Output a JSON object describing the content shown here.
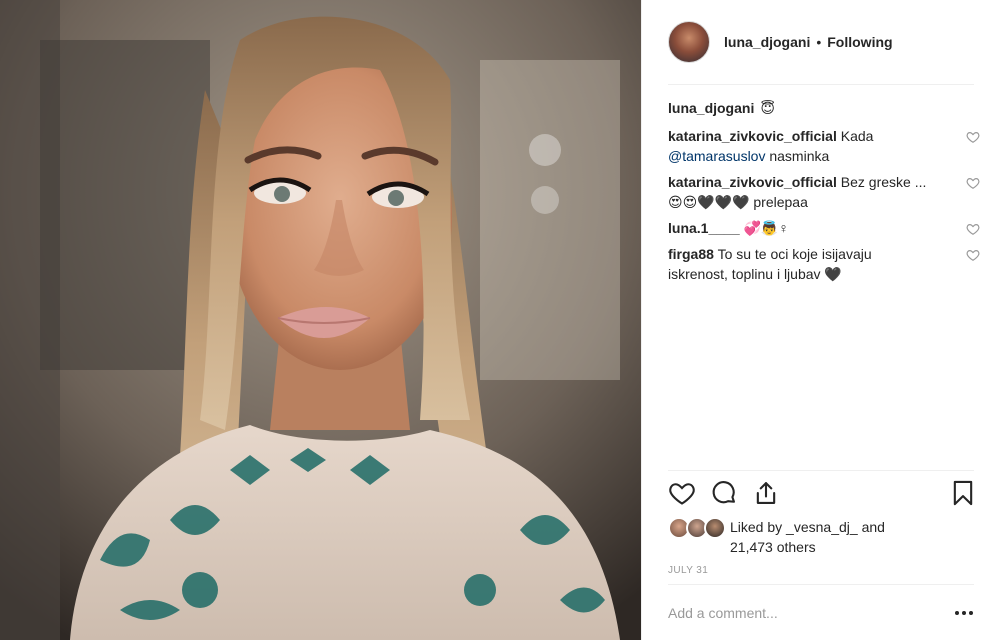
{
  "post": {
    "author": "luna_djogani",
    "separator": "•",
    "follow_status": "Following",
    "caption_emoji": "😇",
    "date": "JULY 31"
  },
  "comments": [
    {
      "author": "katarina_zivkovic_official",
      "line1": "Kada",
      "mention": "@tamarasuslov",
      "line2": "nasminka"
    },
    {
      "author": "katarina_zivkovic_official",
      "line1": "Bez greske ...",
      "line2": "😍😍🖤🖤🖤 prelepaa"
    },
    {
      "author": "luna.1____",
      "line1": "💞👼♀"
    },
    {
      "author": "firga88",
      "line1": "To su te oci koje isijavaju",
      "line2": "iskrenost, toplinu i ljubav 🖤"
    }
  ],
  "likes": {
    "prefix": "Liked by",
    "user": "_vesna_dj_",
    "and": "and",
    "others": "21,473 others"
  },
  "add_comment": {
    "placeholder": "Add a comment..."
  },
  "icons": {
    "like": "heart-icon",
    "comment": "comment-bubble-icon",
    "share": "share-icon",
    "save": "bookmark-icon",
    "more": "more-dots-icon"
  },
  "colors": {
    "text": "#262626",
    "muted": "#999999",
    "mention": "#003569",
    "divider": "#efefef"
  }
}
